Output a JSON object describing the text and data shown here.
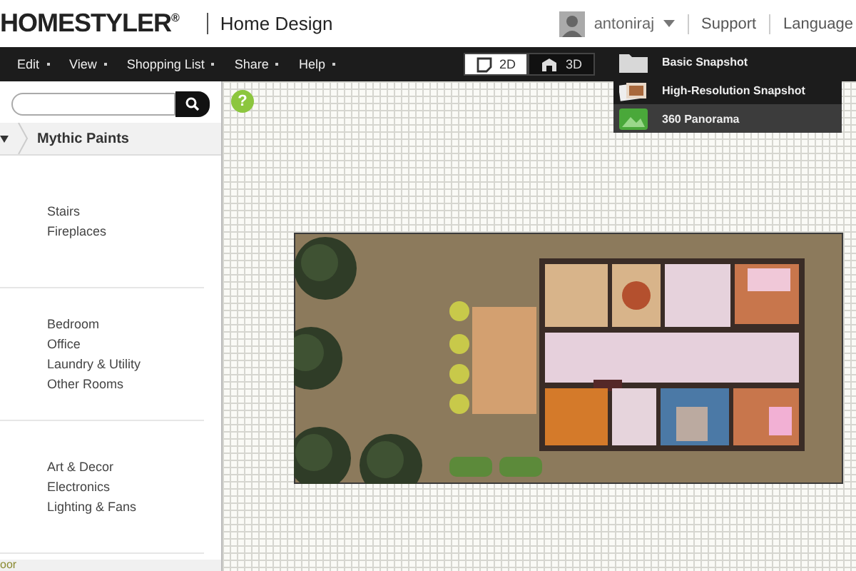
{
  "header": {
    "logo": "HOMESTYLER",
    "logo_mark": "®",
    "app_title": "Home Design",
    "user": "antoniraj",
    "links": [
      "Support",
      "Language"
    ]
  },
  "menu": [
    "Edit",
    "View",
    "Shopping List",
    "Share",
    "Help"
  ],
  "view_toggle": [
    {
      "label": "2D",
      "selected": true
    },
    {
      "label": "3D",
      "selected": false
    }
  ],
  "snapshot_menu": [
    {
      "label": "Basic Snapshot",
      "kind": "folder",
      "selected": false
    },
    {
      "label": "High-Resolution Snapshot",
      "kind": "photos",
      "selected": false
    },
    {
      "label": "360 Panorama",
      "kind": "panorama",
      "selected": true
    }
  ],
  "help_badge": "?",
  "sidebar": {
    "breadcrumb": "Mythic Paints",
    "groups": [
      [
        "Stairs",
        "Fireplaces"
      ],
      [
        "Bedroom",
        "Office",
        "Laundry & Utility",
        "Other Rooms"
      ],
      [
        "Art & Decor",
        "Electronics",
        "Lighting & Fans"
      ]
    ],
    "footer": "oor"
  }
}
